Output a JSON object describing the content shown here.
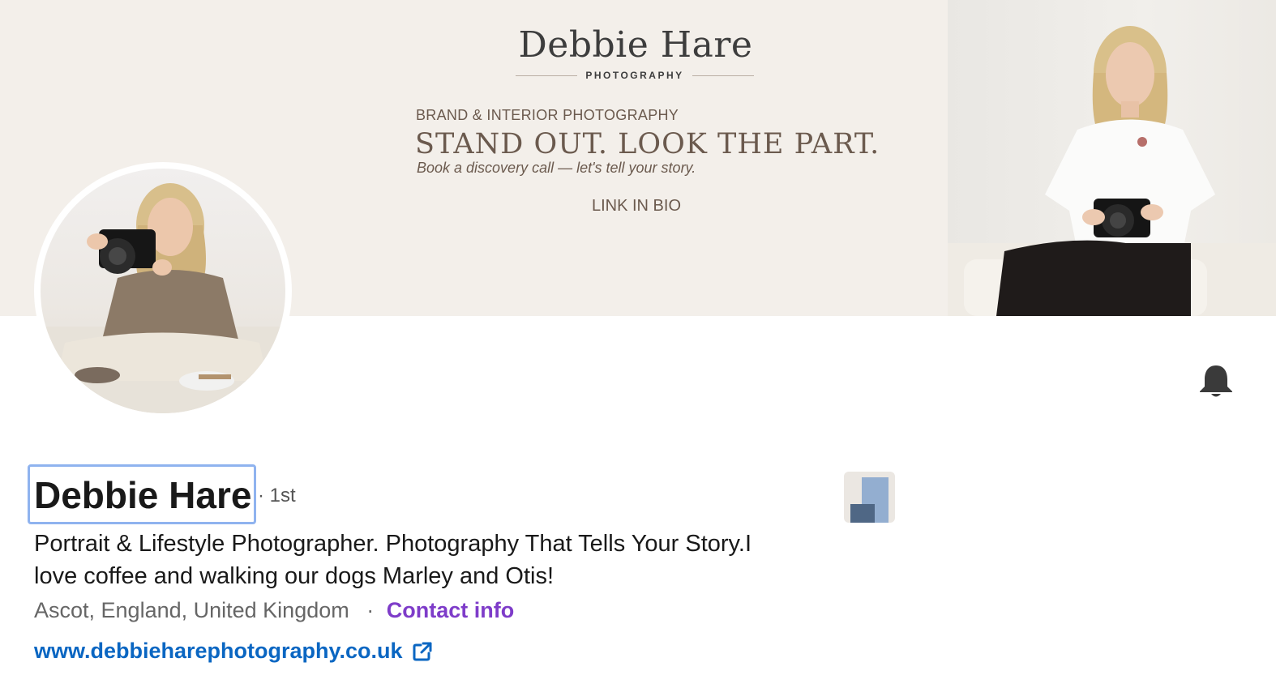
{
  "banner": {
    "brand_name": "Debbie Hare",
    "brand_sub": "PHOTOGRAPHY",
    "kicker": "BRAND & INTERIOR PHOTOGRAPHY",
    "headline": "STAND OUT. LOOK THE PART.",
    "tagline": "Book a discovery call — let's tell your story.",
    "link_text": "LINK IN BIO"
  },
  "profile": {
    "name": "Debbie Hare",
    "degree": "· 1st",
    "headline": "Portrait & Lifestyle Photographer.  Photography That Tells Your Story.I love coffee and walking our dogs Marley and Otis!",
    "location": "Ascot, England, United Kingdom",
    "separator": "·",
    "contact_label": "Contact info",
    "website": "www.debbiehare photography.co.uk"
  },
  "icons": {
    "bell": "bell-icon",
    "external_link": "external-link-icon",
    "company_logo": "company-logo-icon"
  },
  "colors": {
    "link_blue": "#0a66c2",
    "contact_purple": "#7e3cc9",
    "focus_ring": "#8fb3ef",
    "banner_bg": "#f3efea"
  }
}
